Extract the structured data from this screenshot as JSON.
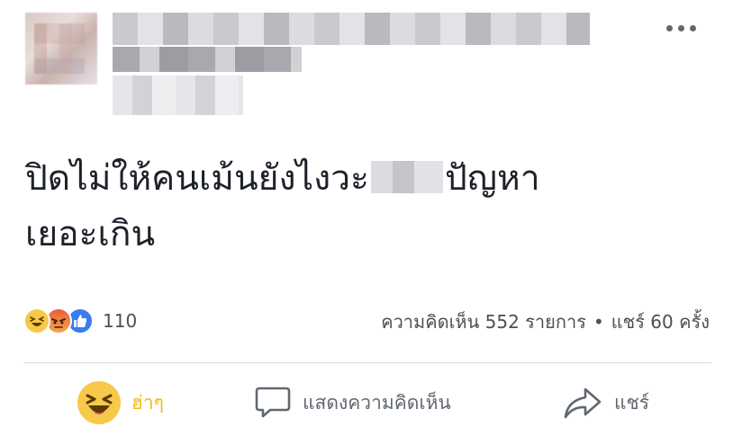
{
  "post": {
    "text_line1_a": "ปิดไม่ให้คนเม้นยังไงวะ",
    "text_line1_b": "ปัญหา",
    "text_line2": "เยอะเกิน"
  },
  "reactions": {
    "count": "110",
    "icons": [
      "haha-icon",
      "angry-icon",
      "like-icon"
    ]
  },
  "summary": {
    "comments": "ความคิดเห็น 552 รายการ",
    "separator": "•",
    "shares": "แชร์ 60 ครั้ง"
  },
  "actions": {
    "haha_label": "ฮ่าๆ",
    "comment_label": "แสดงความคิดเห็น",
    "share_label": "แชร์"
  },
  "colors": {
    "haha": "#f0ba15",
    "like": "#3b7cf0",
    "text": "#1d2129",
    "muted": "#606770"
  }
}
